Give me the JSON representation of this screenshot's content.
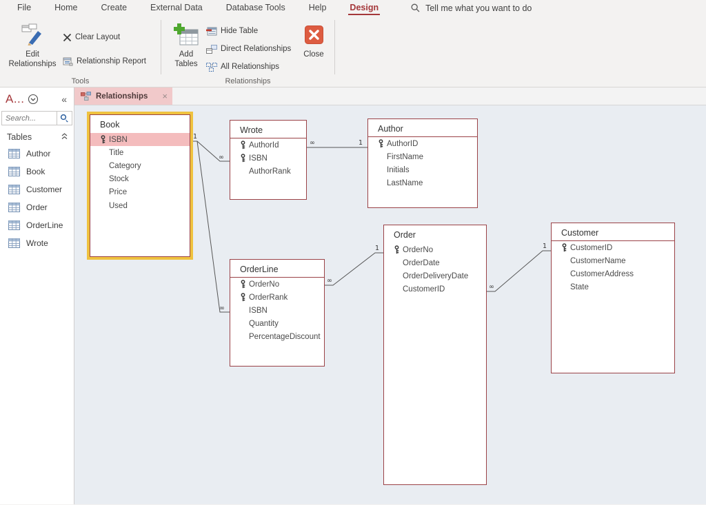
{
  "menubar": {
    "items": [
      "File",
      "Home",
      "Create",
      "External Data",
      "Database Tools",
      "Help",
      "Design"
    ],
    "active_item": "Design",
    "tell_me_label": "Tell me what you want to do"
  },
  "ribbon": {
    "tools_group": {
      "label": "Tools",
      "edit_relationships": "Edit Relationships",
      "clear_layout": "Clear Layout",
      "relationship_report": "Relationship Report"
    },
    "relationships_group": {
      "label": "Relationships",
      "add_tables": "Add Tables",
      "hide_table": "Hide Table",
      "direct_relationships": "Direct Relationships",
      "all_relationships": "All Relationships",
      "close": "Close"
    }
  },
  "sidebar": {
    "title": "A...",
    "collapse_glyph": "«",
    "search_placeholder": "Search...",
    "group_label": "Tables",
    "items": [
      {
        "label": "Author"
      },
      {
        "label": "Book"
      },
      {
        "label": "Customer"
      },
      {
        "label": "Order"
      },
      {
        "label": "OrderLine"
      },
      {
        "label": "Wrote"
      }
    ]
  },
  "tabbar": {
    "active_tab": "Relationships",
    "close_glyph": "×"
  },
  "canvas": {
    "tables": [
      {
        "name": "Book",
        "selected": true,
        "fields": [
          {
            "name": "ISBN",
            "key": true,
            "highlighted": true
          },
          {
            "name": "Title"
          },
          {
            "name": "Category"
          },
          {
            "name": "Stock"
          },
          {
            "name": "Price"
          },
          {
            "name": "Used"
          }
        ]
      },
      {
        "name": "Wrote",
        "fields": [
          {
            "name": "AuthorId",
            "key": true
          },
          {
            "name": "ISBN",
            "key": true
          },
          {
            "name": "AuthorRank"
          }
        ]
      },
      {
        "name": "Author",
        "fields": [
          {
            "name": "AuthorID",
            "key": true
          },
          {
            "name": "FirstName"
          },
          {
            "name": "Initials"
          },
          {
            "name": "LastName"
          }
        ]
      },
      {
        "name": "OrderLine",
        "fields": [
          {
            "name": "OrderNo",
            "key": true
          },
          {
            "name": "OrderRank",
            "key": true
          },
          {
            "name": "ISBN"
          },
          {
            "name": "Quantity"
          },
          {
            "name": "PercentageDiscount"
          }
        ]
      },
      {
        "name": "Order",
        "fields": [
          {
            "name": "OrderNo",
            "key": true
          },
          {
            "name": "OrderDate"
          },
          {
            "name": "OrderDeliveryDate"
          },
          {
            "name": "CustomerID"
          }
        ]
      },
      {
        "name": "Customer",
        "fields": [
          {
            "name": "CustomerID",
            "key": true
          },
          {
            "name": "CustomerName"
          },
          {
            "name": "CustomerAddress"
          },
          {
            "name": "State"
          }
        ]
      }
    ],
    "relationships": [
      {
        "from_table": "Book",
        "from_field": "ISBN",
        "from_card": "1",
        "to_table": "Wrote",
        "to_field": "ISBN",
        "to_card": "∞"
      },
      {
        "from_table": "Book",
        "from_field": "ISBN",
        "from_card": "1",
        "to_table": "OrderLine",
        "to_field": "ISBN",
        "to_card": "∞"
      },
      {
        "from_table": "Author",
        "from_field": "AuthorID",
        "from_card": "1",
        "to_table": "Wrote",
        "to_field": "AuthorId",
        "to_card": "∞"
      },
      {
        "from_table": "Order",
        "from_field": "OrderNo",
        "from_card": "1",
        "to_table": "OrderLine",
        "to_field": "OrderNo",
        "to_card": "∞"
      },
      {
        "from_table": "Customer",
        "from_field": "CustomerID",
        "from_card": "1",
        "to_table": "Order",
        "to_field": "CustomerID",
        "to_card": "∞"
      }
    ]
  },
  "colors": {
    "accent_red": "#a4373a",
    "table_border": "#9a4146",
    "selected_border": "#efc23f",
    "highlight_row": "#f4bcbd",
    "tab_pink": "#f1c9ca",
    "close_button": "#dd5c41",
    "canvas_bg": "#e9edf2"
  }
}
